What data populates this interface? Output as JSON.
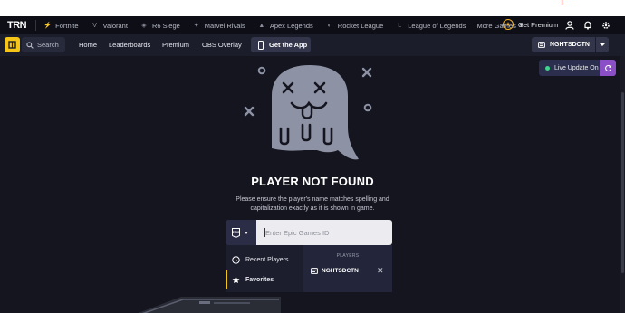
{
  "games_bar": {
    "logo": "TRN",
    "games": [
      {
        "label": "Fortnite",
        "icon": "fortnite-icon"
      },
      {
        "label": "Valorant",
        "icon": "valorant-icon"
      },
      {
        "label": "R6 Siege",
        "icon": "r6-icon"
      },
      {
        "label": "Marvel Rivals",
        "icon": "marvel-icon"
      },
      {
        "label": "Apex Legends",
        "icon": "apex-icon"
      },
      {
        "label": "Rocket League",
        "icon": "rocket-icon"
      },
      {
        "label": "League of Legends",
        "icon": "lol-icon"
      }
    ],
    "more_games": "More Games",
    "premium": "Get Premium"
  },
  "nav": {
    "search": "Search",
    "links": [
      "Home",
      "Leaderboards",
      "Premium",
      "OBS Overlay"
    ],
    "get_app": "Get the App",
    "username": "NGHTSDCTN"
  },
  "live_update": {
    "label": "Live Update On",
    "status_color": "#3dd68c"
  },
  "not_found": {
    "title": "PLAYER NOT FOUND",
    "description": "Please ensure the player's name matches spelling and capitalization exactly as it is shown in game."
  },
  "search_field": {
    "placeholder": "Enter Epic Games ID",
    "platform": "EPIC"
  },
  "dropdown": {
    "items": [
      {
        "label": "Recent Players",
        "icon": "clock-icon"
      },
      {
        "label": "Favorites",
        "icon": "star-icon"
      }
    ],
    "players_label": "PLAYERS",
    "player_name": "NGHTSDCTN"
  },
  "colors": {
    "accent": "#f5c518",
    "background": "#14151f",
    "nav": "#1b1d2b",
    "premium": "#f5b52a",
    "live_refresh": "#8a4fc7"
  }
}
